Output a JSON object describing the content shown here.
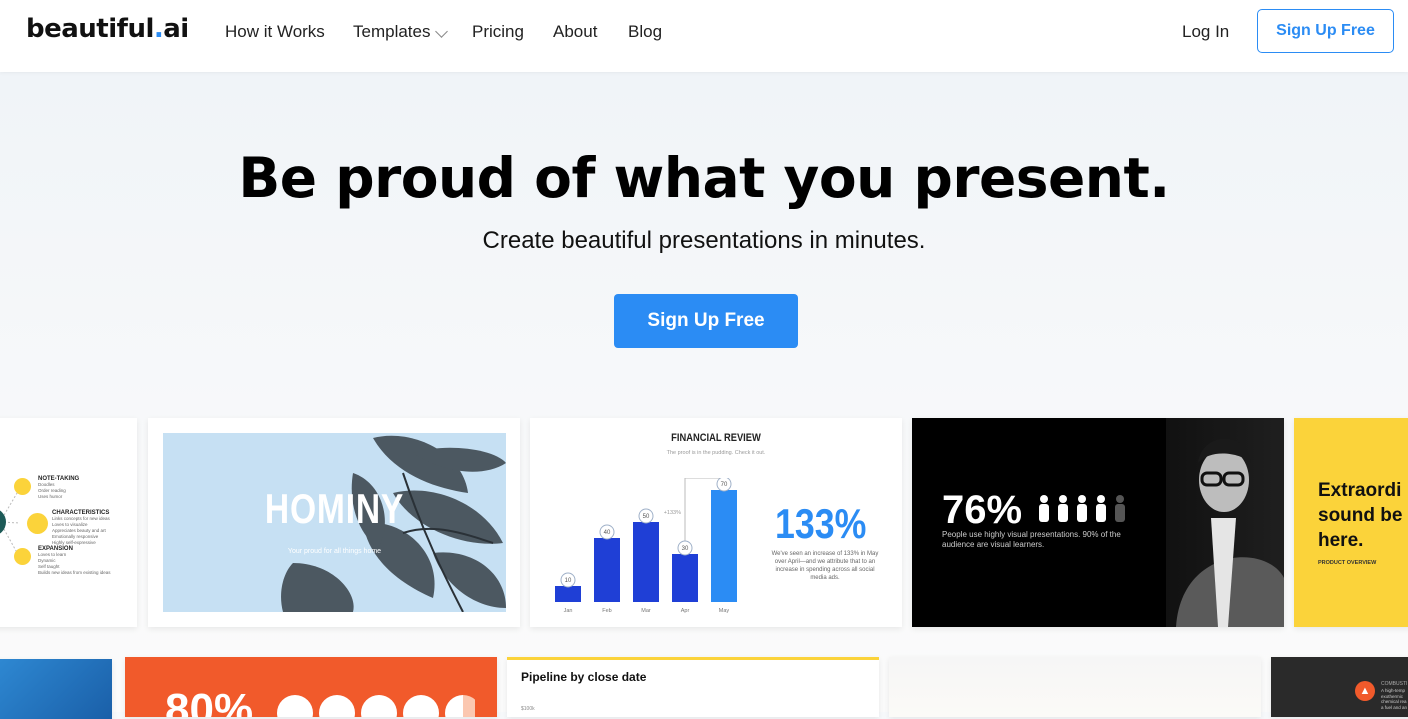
{
  "nav": {
    "logo_main": "beautiful",
    "logo_dot": ".",
    "logo_suffix": "ai",
    "links": [
      "How it Works",
      "Templates",
      "Pricing",
      "About",
      "Blog"
    ],
    "login": "Log In",
    "signup": "Sign Up Free"
  },
  "hero": {
    "title": "Be proud of what you present.",
    "subtitle": "Create beautiful presentations in minutes.",
    "cta": "Sign Up Free"
  },
  "slides": {
    "mindmap": {
      "items": [
        {
          "title": "NOTE-TAKING",
          "lines": [
            "Doodles",
            "Order reading",
            "Uses humor"
          ]
        },
        {
          "title": "CHARACTERISTICS",
          "lines": [
            "Links concepts for new ideas",
            "Loves to visualize",
            "Appreciates beauty and art",
            "Emotionally responsive",
            "Highly self-expressive"
          ]
        },
        {
          "title": "EXPANSION",
          "lines": [
            "Loves to learn",
            "Dynamic",
            "Self taught",
            "Builds new ideas from existing ideas"
          ]
        }
      ]
    },
    "hominy": {
      "title": "HOMINY",
      "subtitle": "Your proud for all things home"
    },
    "financial": {
      "title": "FINANCIAL REVIEW",
      "subtitle": "The proof is in the pudding. Check it out.",
      "big_number": "133%",
      "description": "We've seen an increase of 133% in May over April—and we attribute that to an increase in spending across all social media ads.",
      "delta_label": "+133%",
      "chart_data": {
        "type": "bar",
        "categories": [
          "Jan",
          "Feb",
          "Mar",
          "Apr",
          "May"
        ],
        "values": [
          10,
          40,
          50,
          30,
          70
        ],
        "ylim": [
          0,
          70
        ]
      }
    },
    "stat": {
      "big": "76%",
      "text": "People use highly visual presentations. 90% of the audience are visual learners."
    },
    "product": {
      "title_lines": [
        "Extraordi",
        "sound be",
        "here."
      ],
      "label": "PRODUCT OVERVIEW"
    },
    "row2": {
      "orange_big": "80%",
      "pipeline_title": "Pipeline by close date",
      "pipeline_tick": "$100k",
      "dark_label": "COMBUSTI",
      "dark_lines": [
        "A high-temp",
        "exothermic",
        "chemical rea",
        "a fuel and an"
      ]
    }
  },
  "colors": {
    "accent": "#2b8cf4",
    "bar_dark": "#1f3fd6",
    "bar_light": "#2b8cf4",
    "yellow": "#fbd33a",
    "orange": "#f15a2b"
  }
}
